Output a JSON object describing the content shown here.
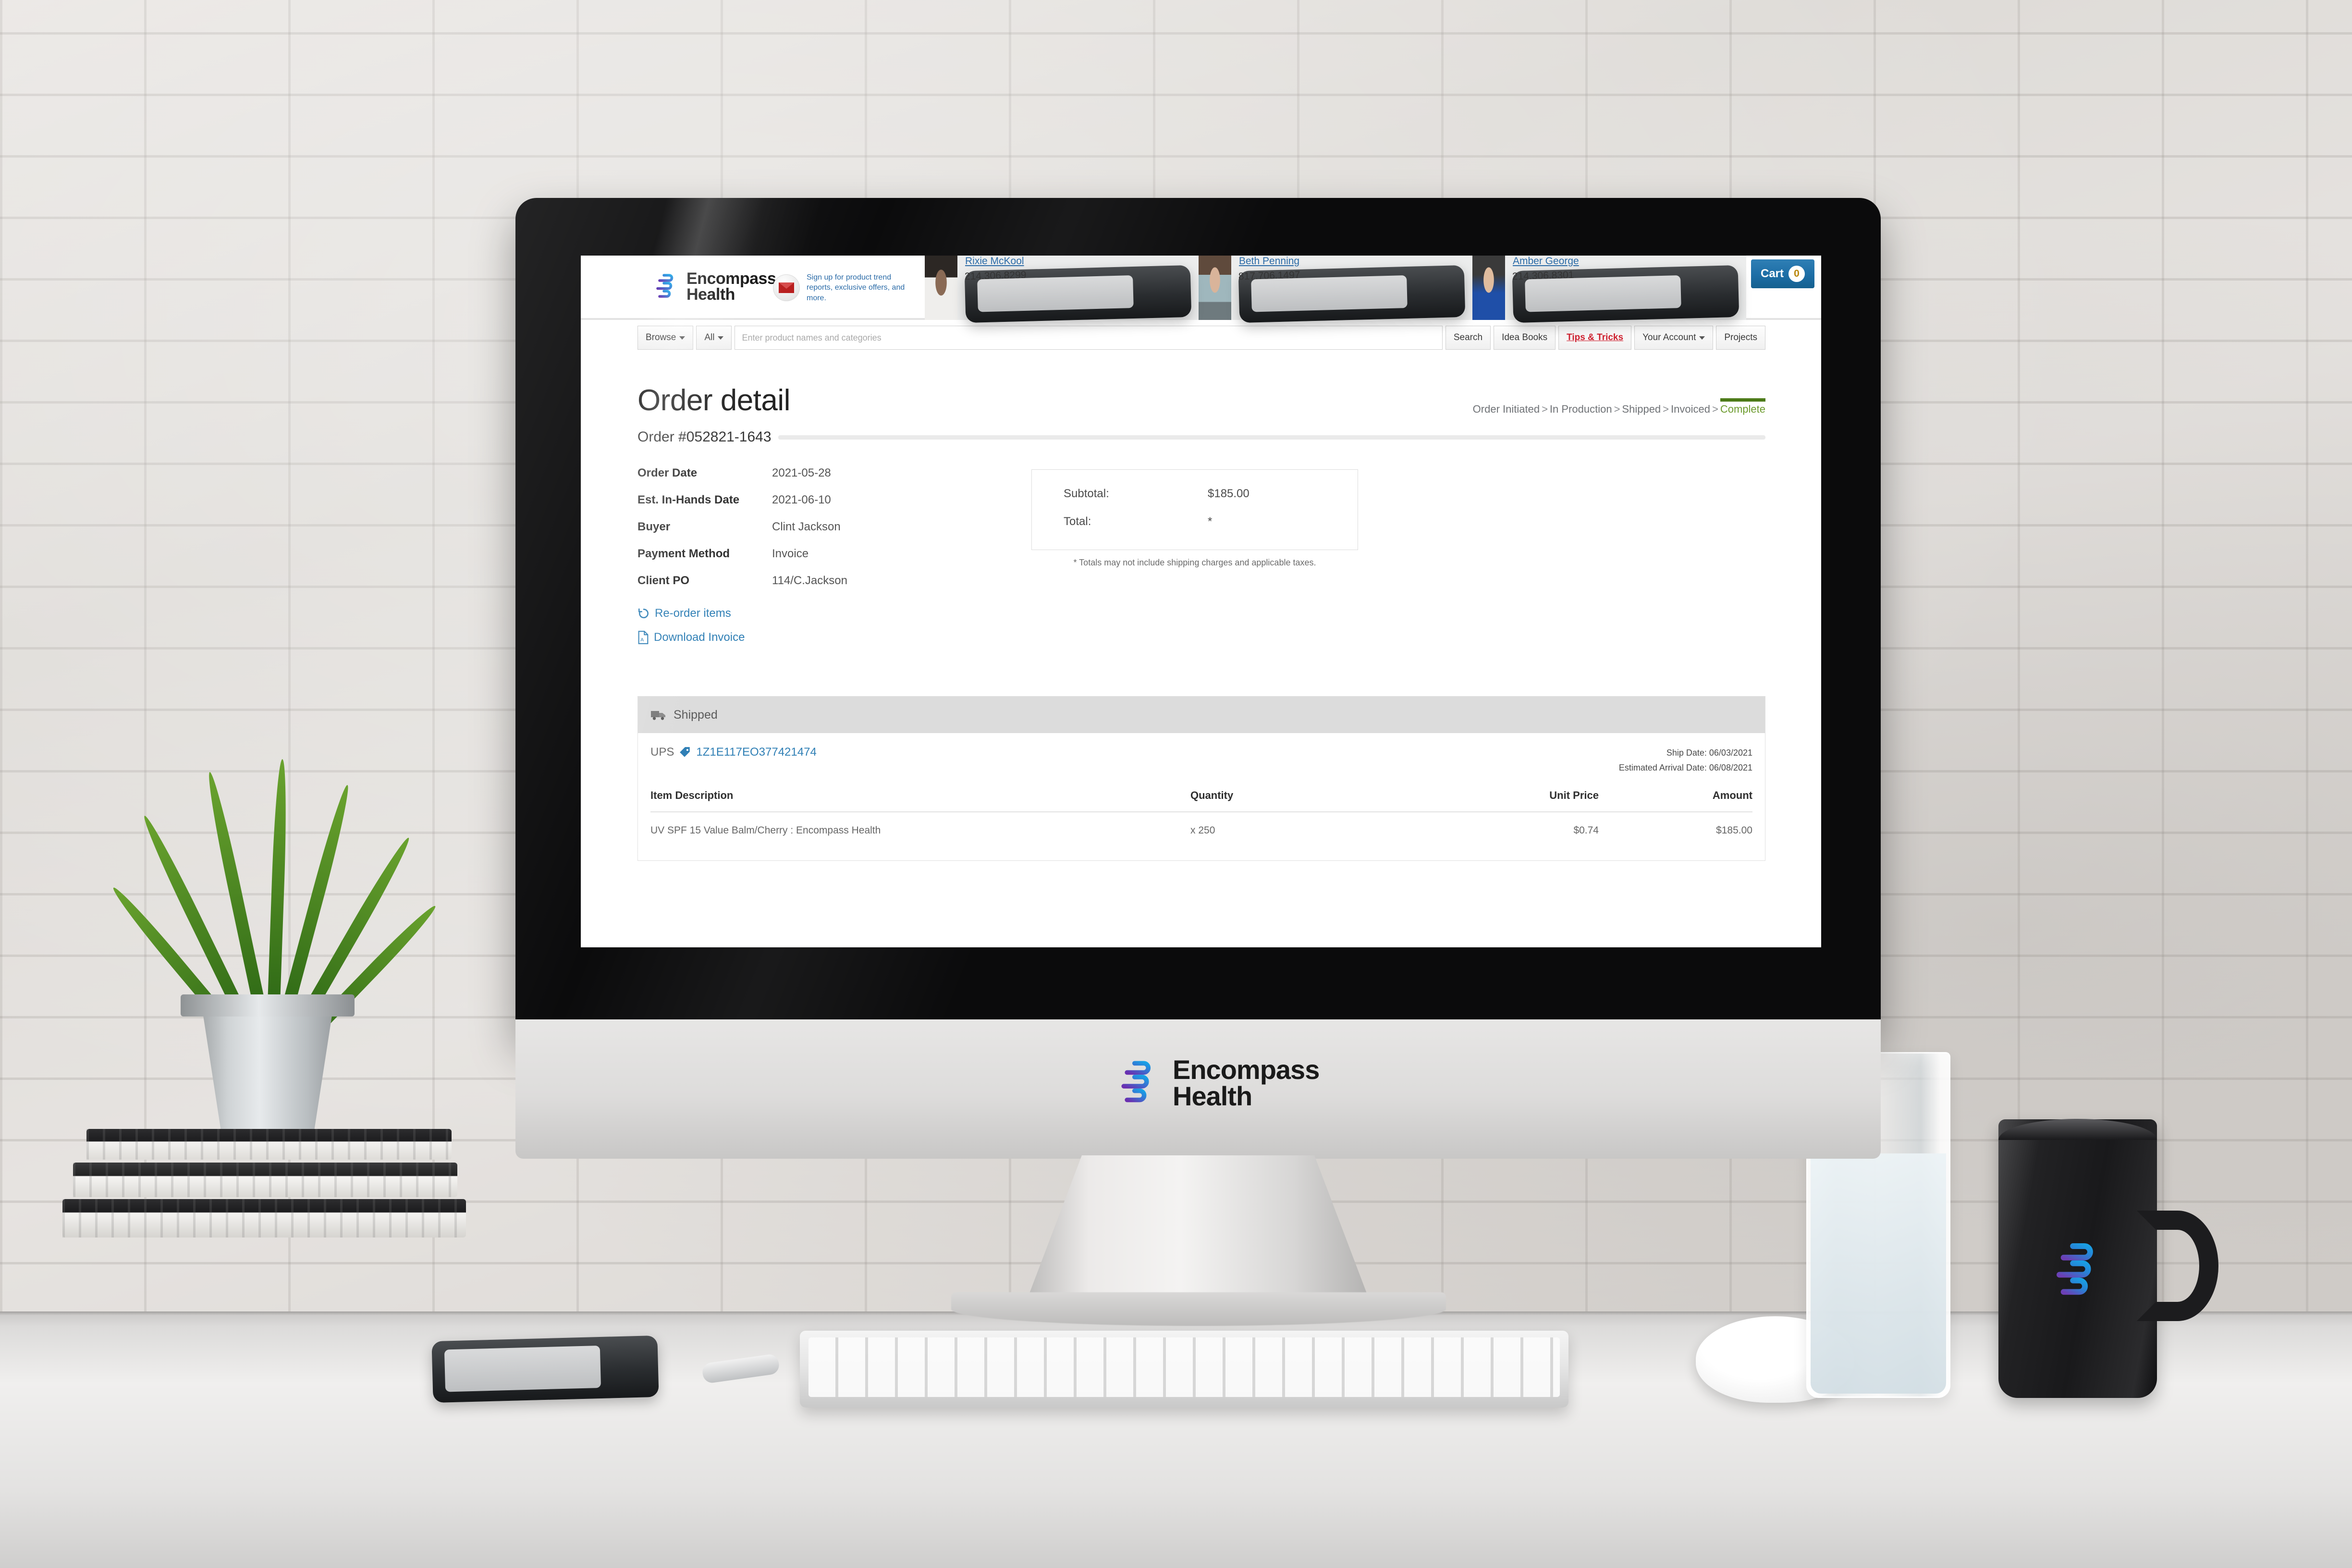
{
  "brand": {
    "name_line1": "Encompass",
    "name_line2": "Health",
    "logo_gradient_start": "#7b3fbf",
    "logo_gradient_end": "#0f9ae0"
  },
  "header": {
    "signup_text": "Sign up for product trend reports, exclusive offers, and more.",
    "envelope_icon": "envelope-icon",
    "contacts": [
      {
        "name": "Rixie McKool",
        "phone": "214.306.8299"
      },
      {
        "name": "Beth Penning",
        "phone": "817.706.1497"
      },
      {
        "name": "Amber George",
        "phone": "214.306.8301"
      }
    ],
    "cart_label": "Cart",
    "cart_count": "0"
  },
  "nav": {
    "browse_label": "Browse",
    "category_label": "All",
    "search_placeholder": "Enter product names and categories",
    "search_value": "",
    "search_button": "Search",
    "idea_books": "Idea Books",
    "tips_tricks": "Tips & Tricks",
    "your_account": "Your Account",
    "projects": "Projects"
  },
  "page": {
    "title": "Order detail",
    "order_number": "Order #052821-1643",
    "status_steps": [
      "Order Initiated",
      "In Production",
      "Shipped",
      "Invoiced"
    ],
    "status_current": "Complete",
    "status_current_color": "#6c9b2d"
  },
  "details": {
    "rows": [
      {
        "label": "Order Date",
        "value": "2021-05-28"
      },
      {
        "label": "Est. In-Hands Date",
        "value": "2021-06-10"
      },
      {
        "label": "Buyer",
        "value": "Clint Jackson"
      },
      {
        "label": "Payment Method",
        "value": "Invoice"
      },
      {
        "label": "Client PO",
        "value": "114/C.Jackson"
      }
    ],
    "reorder_label": "Re-order items",
    "download_label": "Download Invoice"
  },
  "totals": {
    "subtotal_label": "Subtotal:",
    "subtotal_value": "$185.00",
    "total_label": "Total:",
    "total_value": "*",
    "note": "* Totals may not include shipping charges and applicable taxes."
  },
  "shipment": {
    "header_label": "Shipped",
    "truck_icon": "truck-icon",
    "carrier": "UPS",
    "tracking_number": "1Z1E117EO377421474",
    "ship_date": "Ship Date: 06/03/2021",
    "estimated_arrival": "Estimated Arrival Date: 06/08/2021",
    "table": {
      "columns": [
        "Item Description",
        "Quantity",
        "Unit Price",
        "Amount"
      ],
      "rows": [
        {
          "description": "UV SPF 15 Value Balm/Cherry : Encompass Health",
          "quantity": "x 250",
          "unit_price": "$0.74",
          "amount": "$185.00"
        }
      ]
    }
  }
}
